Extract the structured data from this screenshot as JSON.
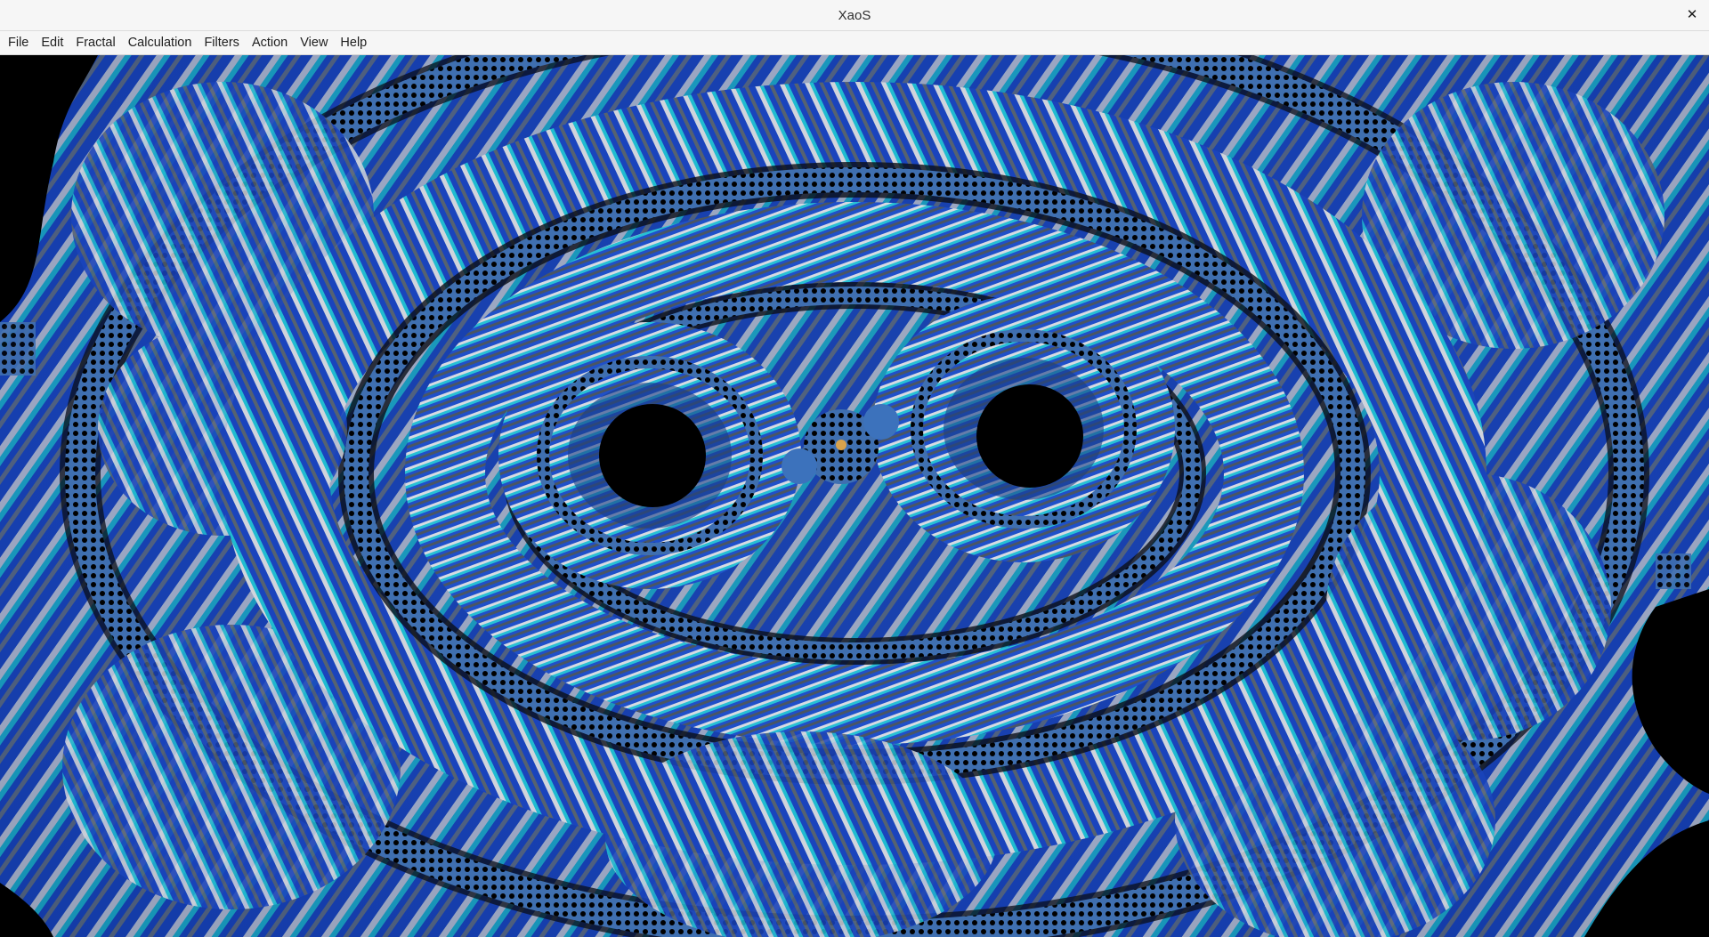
{
  "window": {
    "title": "XaoS",
    "close_glyph": "✕"
  },
  "menubar": {
    "items": [
      {
        "label": "File"
      },
      {
        "label": "Edit"
      },
      {
        "label": "Fractal"
      },
      {
        "label": "Calculation"
      },
      {
        "label": "Filters"
      },
      {
        "label": "Action"
      },
      {
        "label": "View"
      },
      {
        "label": "Help"
      }
    ]
  },
  "fractal_view": {
    "palette": {
      "deep_blue": "#1238b8",
      "cyan": "#12b8cc",
      "silver": "#c8ccd4",
      "gray": "#707a84",
      "filament": "#6aa6e8",
      "interior": "#000000"
    }
  }
}
